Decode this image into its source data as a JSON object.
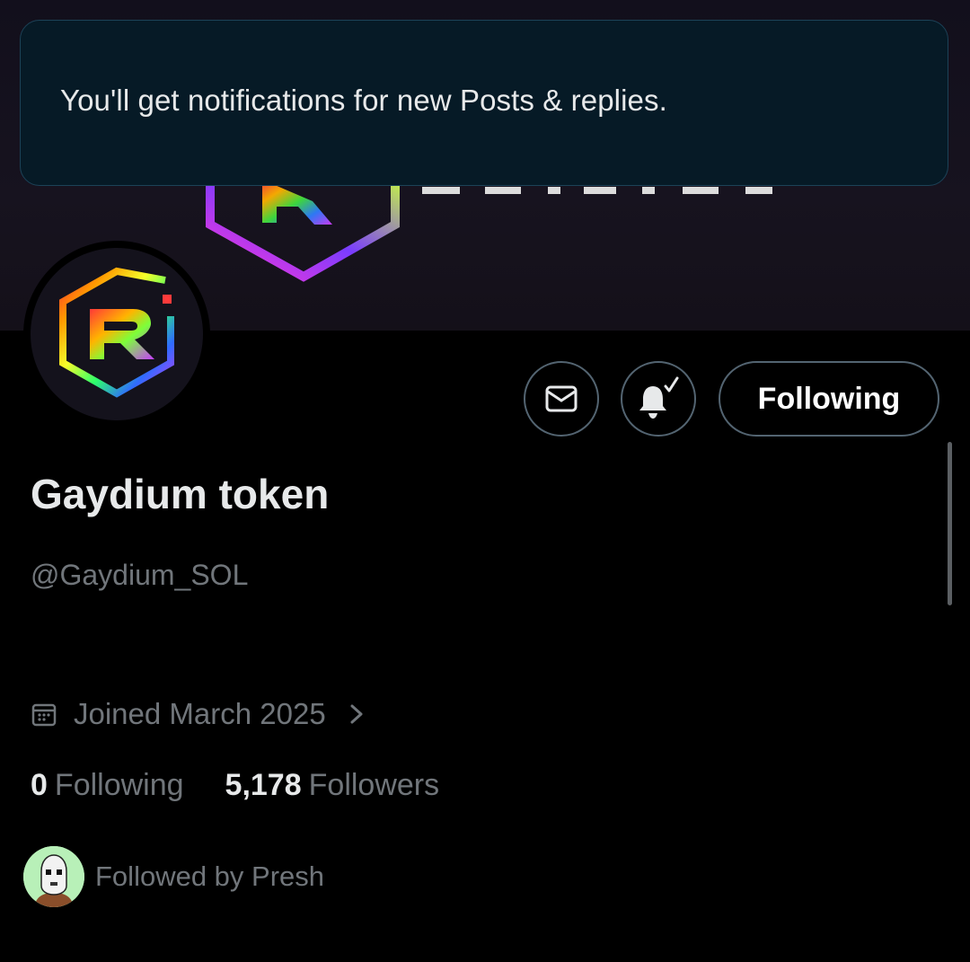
{
  "toast": {
    "message": "You'll get notifications for new Posts & replies."
  },
  "profile": {
    "display_name": "Gaydium token",
    "handle": "@Gaydium_SOL",
    "joined": "Joined March 2025",
    "following_count": "0",
    "following_label": "Following",
    "followers_count": "5,178",
    "followers_label": "Followers",
    "followed_by": "Followed by Presh"
  },
  "actions": {
    "message_icon": "mail-icon",
    "notifications_icon": "bell-check-icon",
    "follow_state_label": "Following"
  },
  "colors": {
    "background": "#000000",
    "toast_bg": "#061a26",
    "secondary_text": "#71767b",
    "border": "#536471"
  }
}
